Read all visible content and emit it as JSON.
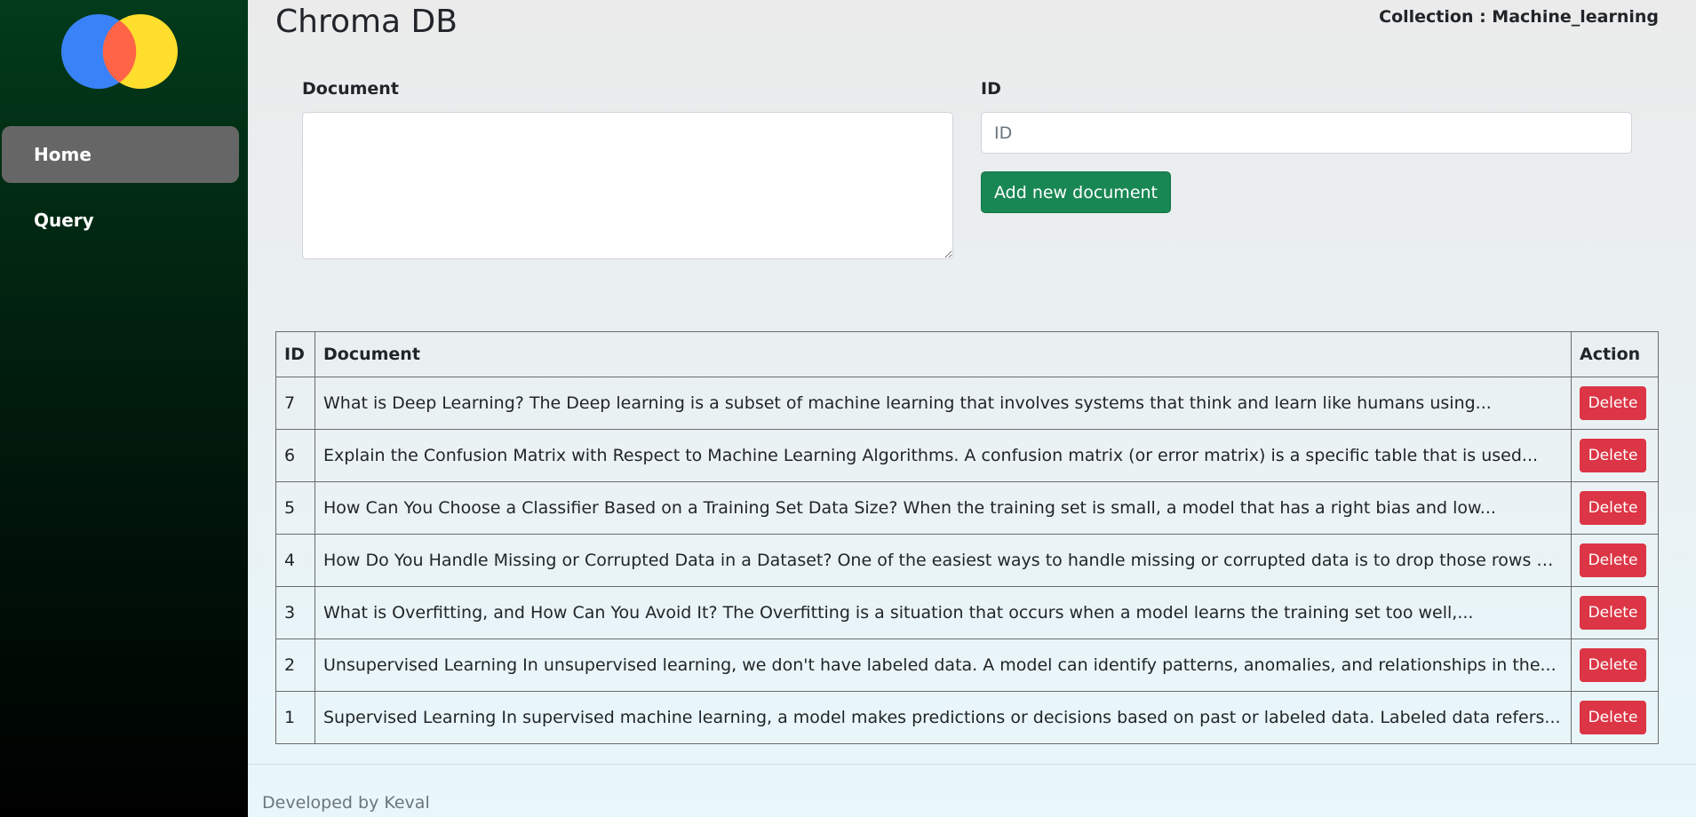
{
  "app": {
    "title": "Chroma DB",
    "collection": "Collection : Machine_learning"
  },
  "sidebar": {
    "logo": "chroma-logo",
    "items": [
      {
        "label": "Home",
        "active": true
      },
      {
        "label": "Query",
        "active": false
      }
    ]
  },
  "form": {
    "document_label": "Document",
    "id_label": "ID",
    "id_placeholder": "ID",
    "document_value": "",
    "id_value": "",
    "add_button_label": "Add new document"
  },
  "table": {
    "headers": [
      "ID",
      "Document",
      "Action"
    ],
    "delete_label": "Delete",
    "rows": [
      {
        "id": "7",
        "document": "What is Deep Learning? The Deep learning is a subset of machine learning that involves systems that think and learn like humans using..."
      },
      {
        "id": "6",
        "document": "Explain the Confusion Matrix with Respect to Machine Learning Algorithms. A confusion matrix (or error matrix) is a specific table that is used..."
      },
      {
        "id": "5",
        "document": "How Can You Choose a Classifier Based on a Training Set Data Size? When the training set is small, a model that has a right bias and low..."
      },
      {
        "id": "4",
        "document": "How Do You Handle Missing or Corrupted Data in a Dataset? One of the easiest ways to handle missing or corrupted data is to drop those rows or..."
      },
      {
        "id": "3",
        "document": "What is Overfitting, and How Can You Avoid It? The Overfitting is a situation that occurs when a model learns the training set too well,..."
      },
      {
        "id": "2",
        "document": "Unsupervised Learning In unsupervised learning, we don't have labeled data. A model can identify patterns, anomalies, and relationships in the..."
      },
      {
        "id": "1",
        "document": "Supervised Learning In supervised machine learning, a model makes predictions or decisions based on past or labeled data. Labeled data refers..."
      }
    ]
  },
  "footer": {
    "text": "Developed by Keval"
  },
  "colors": {
    "sidebar_top": "#023b1b",
    "nav_active": "#666666",
    "add_button": "#198754",
    "delete_button": "#dc3545",
    "logo_blue": "#3a82f7",
    "logo_orange": "#ff6446",
    "logo_yellow": "#ffde2d"
  }
}
